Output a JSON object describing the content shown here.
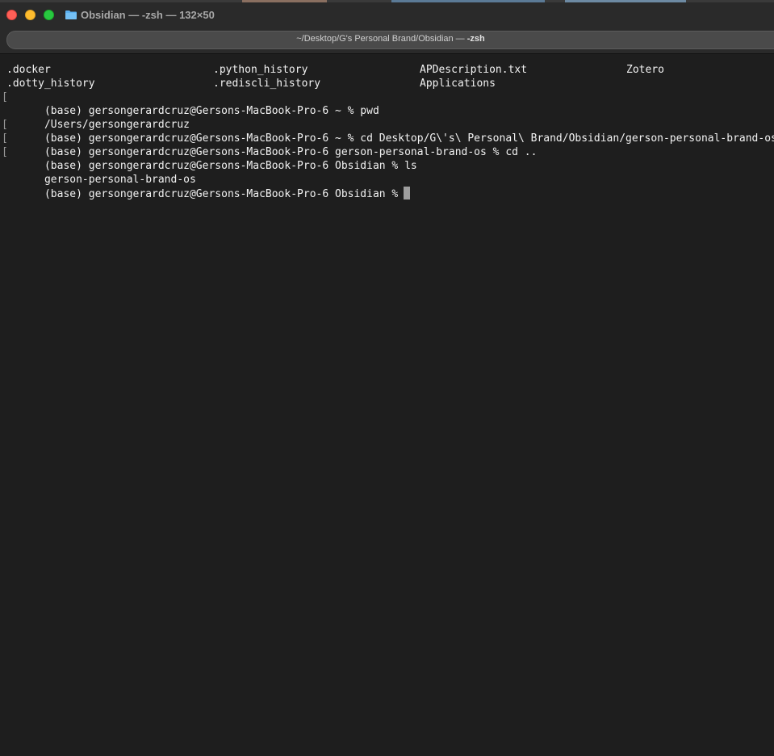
{
  "window": {
    "title": "Obsidian — -zsh — 132×50",
    "tab_path": "~/Desktop/G's Personal Brand/Obsidian — ",
    "tab_process": "-zsh"
  },
  "terminal": {
    "ls_rows": [
      [
        ".docker",
        ".python_history",
        "APDescription.txt",
        "Zotero"
      ],
      [
        ".dotty_history",
        ".rediscli_history",
        "Applications",
        ""
      ]
    ],
    "lines": [
      {
        "mark": "[",
        "text": "(base) gersongerardcruz@Gersons-MacBook-Pro-6 ~ % pwd"
      },
      {
        "mark": "",
        "text": "/Users/gersongerardcruz"
      },
      {
        "mark": "[",
        "text": "(base) gersongerardcruz@Gersons-MacBook-Pro-6 ~ % cd Desktop/G\\'s\\ Personal\\ Brand/Obsidian/gerson-personal-brand-os"
      },
      {
        "mark": "[",
        "text": "(base) gersongerardcruz@Gersons-MacBook-Pro-6 gerson-personal-brand-os % cd .."
      },
      {
        "mark": "[",
        "text": "(base) gersongerardcruz@Gersons-MacBook-Pro-6 Obsidian % ls"
      },
      {
        "mark": "",
        "text": "gerson-personal-brand-os"
      }
    ],
    "prompt": "(base) gersongerardcruz@Gersons-MacBook-Pro-6 Obsidian %"
  },
  "colors": {
    "background": "#1e1e1e",
    "text": "#f2f2f2",
    "close": "#ff5f57",
    "minimize": "#febc2e",
    "maximize": "#28c840",
    "folder": "#5ab0f0"
  }
}
